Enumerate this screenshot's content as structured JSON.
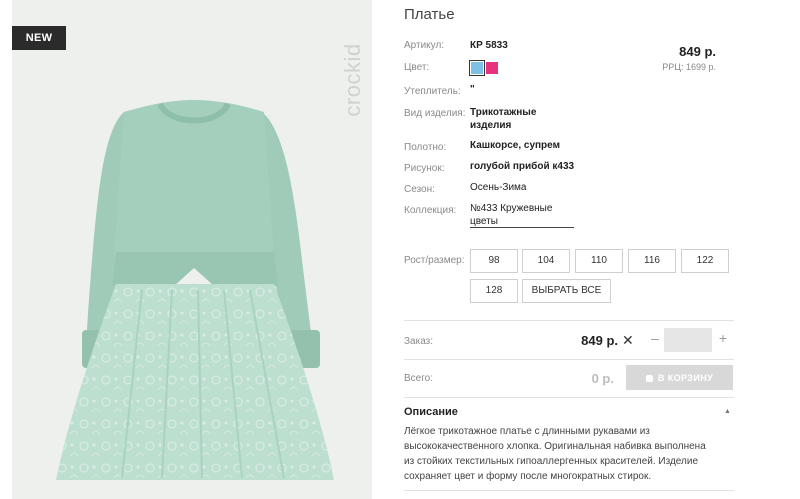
{
  "badge": "NEW",
  "brand": "crockid",
  "title": "Платье",
  "price": "849 р.",
  "rrp": "РРЦ: 1699 р.",
  "specs": [
    {
      "label": "Артикул:",
      "value": "КР 5833",
      "bold": true
    },
    {
      "label": "Цвет:",
      "value": ""
    },
    {
      "label": "Утеплитель:",
      "value": "\"",
      "bold": true
    },
    {
      "label": "Вид изделия:",
      "value": "Трикотажные",
      "value2": "изделия",
      "bold": true
    },
    {
      "label": "Полотно:",
      "value": "Кашкорсе, супрем",
      "bold": true
    },
    {
      "label": "Рисунок:",
      "value": "голубой прибой к433",
      "bold": true
    },
    {
      "label": "Сезон:",
      "value": "Осень-Зима",
      "bold": false
    },
    {
      "label": "Коллекция:",
      "value": "№433 Кружевные",
      "value2": "цветы",
      "bold": false
    }
  ],
  "colors": [
    "#7fc0e6",
    "#e8317e"
  ],
  "sizes_label": "Рост/размер:",
  "sizes": [
    "98",
    "104",
    "110",
    "116",
    "122",
    "128"
  ],
  "select_all": "ВЫБРАТЬ ВСЕ",
  "order": {
    "label": "Заказ:",
    "price": "849 р.",
    "remove_glyph": "✕",
    "minus": "–",
    "plus": "+",
    "quantity": ""
  },
  "total": {
    "label": "Всего:",
    "value": "0 р.",
    "cart_button": "В КОРЗИНУ"
  },
  "description": {
    "heading": "Описание",
    "caret": "▲",
    "lines": [
      "Лёгкое трикотажное платье с длинными рукавами из",
      "высококачественного хлопка. Оригинальная набивка выполнена",
      "из стойких текстильных гипоаллергенных красителей. Изделие",
      "сохраняет цвет и форму после многократных стирок."
    ]
  }
}
